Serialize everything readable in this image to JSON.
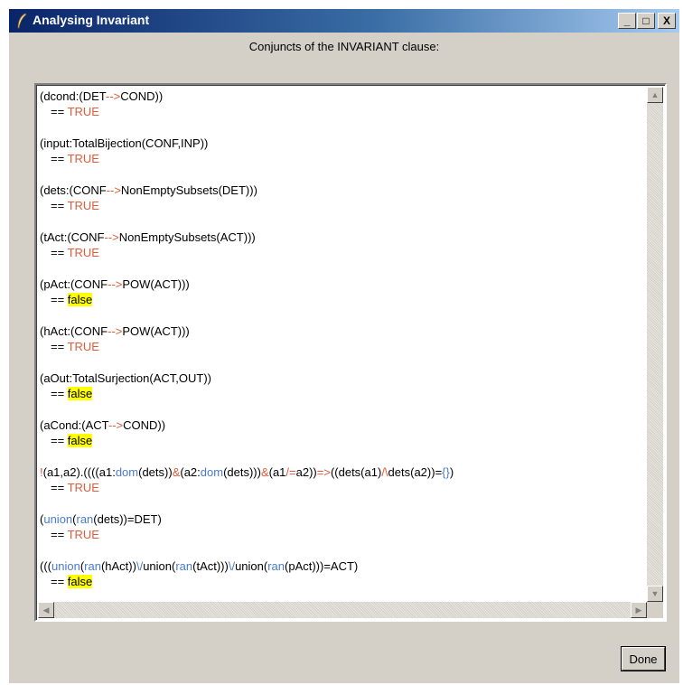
{
  "window": {
    "title": "Analysing Invariant",
    "minimize": "_",
    "maximize": "□",
    "close": "X"
  },
  "heading": "Conjuncts of the INVARIANT clause:",
  "entries": [
    {
      "expr": [
        {
          "t": "(dcond:(DET"
        },
        {
          "t": "-->",
          "c": "op"
        },
        {
          "t": "COND))"
        }
      ],
      "result": "TRUE"
    },
    {
      "expr": [
        {
          "t": "(input:TotalBijection(CONF,INP))"
        }
      ],
      "result": "TRUE"
    },
    {
      "expr": [
        {
          "t": "(dets:(CONF"
        },
        {
          "t": "-->",
          "c": "op"
        },
        {
          "t": "NonEmptySubsets(DET)))"
        }
      ],
      "result": "TRUE"
    },
    {
      "expr": [
        {
          "t": "(tAct:(CONF"
        },
        {
          "t": "-->",
          "c": "op"
        },
        {
          "t": "NonEmptySubsets(ACT)))"
        }
      ],
      "result": "TRUE"
    },
    {
      "expr": [
        {
          "t": "(pAct:(CONF"
        },
        {
          "t": "-->",
          "c": "op"
        },
        {
          "t": "POW(ACT)))"
        }
      ],
      "result": "false"
    },
    {
      "expr": [
        {
          "t": "(hAct:(CONF"
        },
        {
          "t": "-->",
          "c": "op"
        },
        {
          "t": "POW(ACT)))"
        }
      ],
      "result": "TRUE"
    },
    {
      "expr": [
        {
          "t": "(aOut:TotalSurjection(ACT,OUT))"
        }
      ],
      "result": "false"
    },
    {
      "expr": [
        {
          "t": "(aCond:(ACT"
        },
        {
          "t": "-->",
          "c": "op"
        },
        {
          "t": "COND))"
        }
      ],
      "result": "false"
    },
    {
      "expr": [
        {
          "t": "!",
          "c": "op"
        },
        {
          "t": "(a1,a2).((((a1:"
        },
        {
          "t": "dom",
          "c": "kw"
        },
        {
          "t": "(dets))"
        },
        {
          "t": "&",
          "c": "op"
        },
        {
          "t": "(a2:"
        },
        {
          "t": "dom",
          "c": "kw"
        },
        {
          "t": "(dets)))"
        },
        {
          "t": "&",
          "c": "op"
        },
        {
          "t": "(a1"
        },
        {
          "t": "/=",
          "c": "op"
        },
        {
          "t": "a2))"
        },
        {
          "t": "=>",
          "c": "op"
        },
        {
          "t": "((dets(a1)"
        },
        {
          "t": "/\\",
          "c": "op"
        },
        {
          "t": "dets(a2))="
        },
        {
          "t": "{}",
          "c": "kw"
        },
        {
          "t": ")"
        }
      ],
      "result": "TRUE"
    },
    {
      "expr": [
        {
          "t": "("
        },
        {
          "t": "union",
          "c": "kw"
        },
        {
          "t": "("
        },
        {
          "t": "ran",
          "c": "kw"
        },
        {
          "t": "(dets))=DET)"
        }
      ],
      "result": "TRUE"
    },
    {
      "expr": [
        {
          "t": "((("
        },
        {
          "t": "union",
          "c": "kw"
        },
        {
          "t": "("
        },
        {
          "t": "ran",
          "c": "kw"
        },
        {
          "t": "(hAct))"
        },
        {
          "t": "\\/",
          "c": "kw"
        },
        {
          "t": "union("
        },
        {
          "t": "ran",
          "c": "kw"
        },
        {
          "t": "(tAct)))"
        },
        {
          "t": "\\/",
          "c": "kw"
        },
        {
          "t": "union("
        },
        {
          "t": "ran",
          "c": "kw"
        },
        {
          "t": "(pAct)))=ACT)"
        }
      ],
      "result": "false"
    }
  ],
  "eq_prefix": "== ",
  "done_label": "Done",
  "colors": {
    "operator": "#e05a3a",
    "keyword": "#4a7bd0",
    "false_highlight": "#ffff00"
  }
}
